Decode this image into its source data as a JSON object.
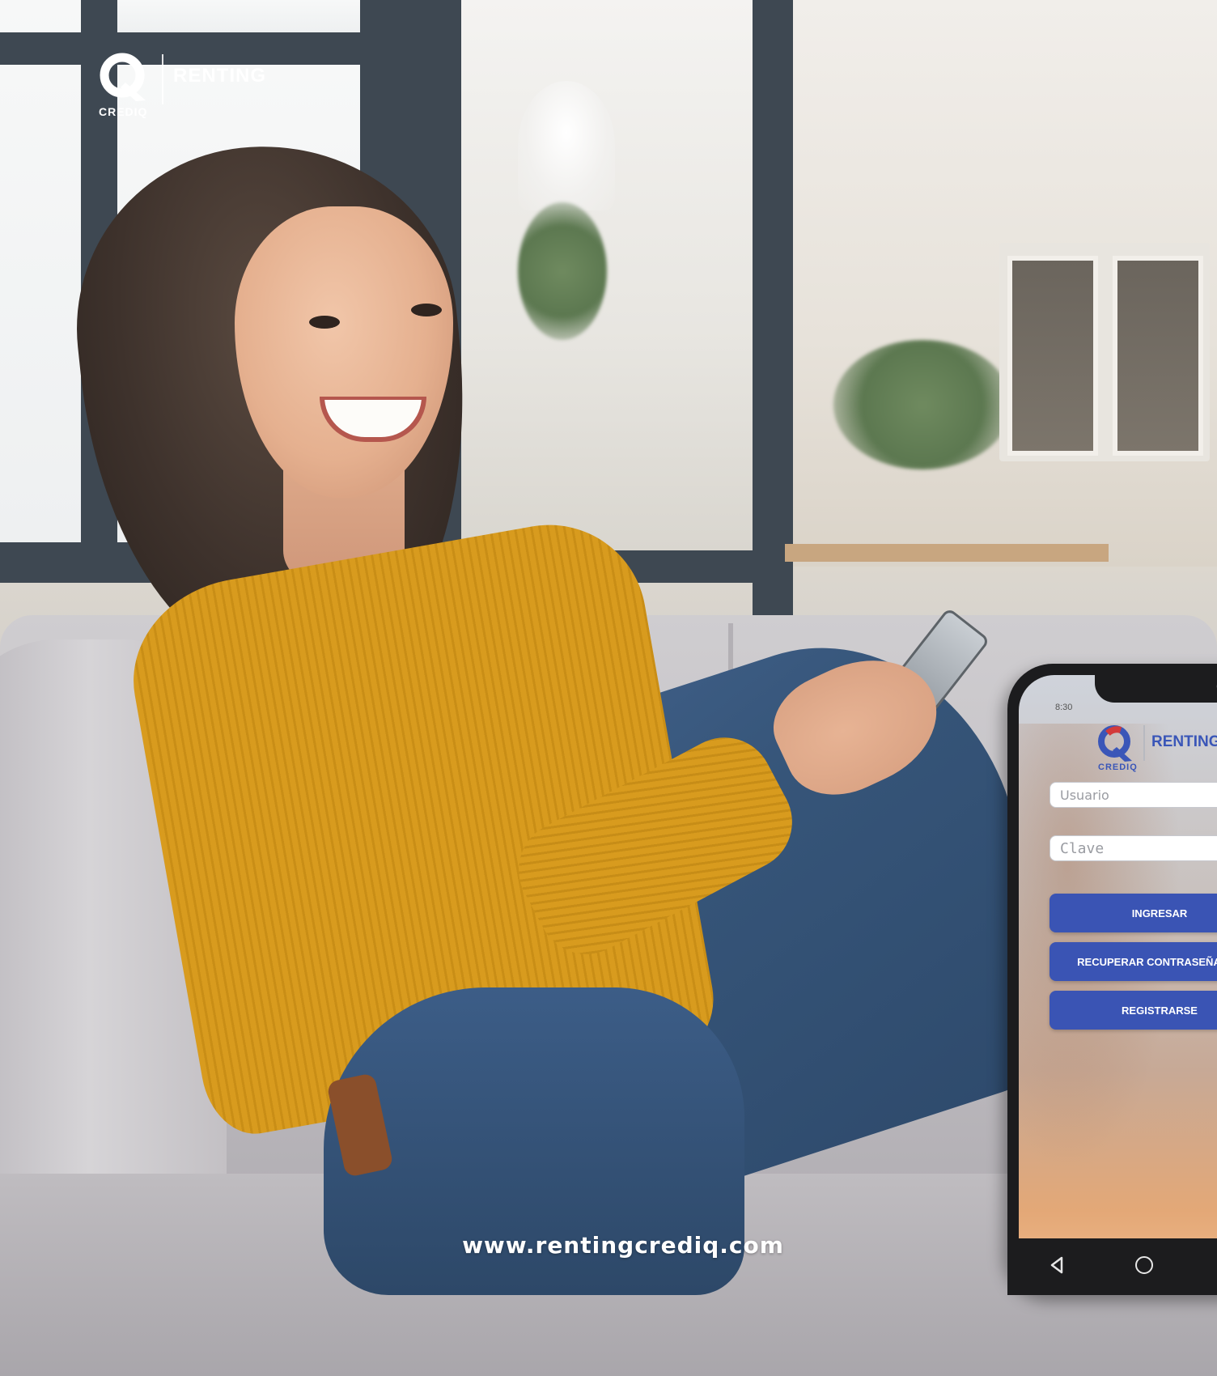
{
  "brand": {
    "renting": "RENTING",
    "crediq": "CREDIQ",
    "color": "#ffffff"
  },
  "website": "www.rentingcrediq.com",
  "phone": {
    "status_time": "8:30",
    "app": {
      "logo": {
        "renting": "RENTING",
        "crediq": "CREDIQ",
        "brand_color": "#3a56b8"
      },
      "user_field": {
        "placeholder": "Usuario",
        "value": ""
      },
      "password_field": {
        "placeholder": "Clave",
        "value": ""
      },
      "buttons": {
        "ingresar": "INGRESAR",
        "recuperar": "RECUPERAR CONTRASEÑA",
        "registrarse": "REGISTRARSE",
        "color": "#3a54b4"
      }
    },
    "nav": {
      "back_icon": "triangle-back-icon",
      "home_icon": "circle-home-icon"
    }
  }
}
